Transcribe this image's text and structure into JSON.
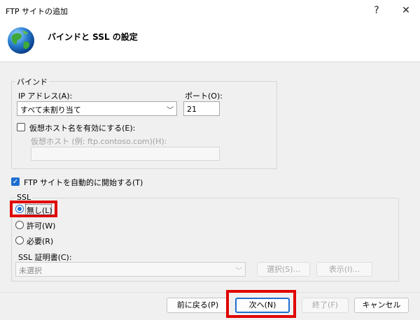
{
  "window": {
    "title": "FTP サイトの追加",
    "help_glyph": "?",
    "close_glyph": "✕"
  },
  "header": {
    "title": "バインドと SSL の設定"
  },
  "binding": {
    "group_label": "バインド",
    "ip_label": "IP アドレス(A):",
    "ip_value": "すべて未割り当て",
    "port_label": "ポート(O):",
    "port_value": "21",
    "virtual_host_checkbox_label": "仮想ホスト名を有効にする(E):",
    "virtual_host_checked": false,
    "virtual_host_label": "仮想ホスト (例: ftp.contoso.com)(H):",
    "virtual_host_value": ""
  },
  "autostart": {
    "label": "FTP サイトを自動的に開始する(T)",
    "checked": true
  },
  "ssl": {
    "group_label": "SSL",
    "options": [
      {
        "label": "無し(L)",
        "selected": true
      },
      {
        "label": "許可(W)",
        "selected": false
      },
      {
        "label": "必要(R)",
        "selected": false
      }
    ],
    "cert_label": "SSL 証明書(C):",
    "cert_value": "未選択",
    "select_button": "選択(S)...",
    "view_button": "表示(I)..."
  },
  "footer": {
    "back_button": "前に戻る(P)",
    "next_button": "次へ(N)",
    "finish_button": "終了(F)",
    "cancel_button": "キャンセル"
  },
  "colors": {
    "accent": "#1e6fd0",
    "highlight": "#e00000"
  },
  "icons": {
    "header": "globe-icon",
    "dropdown": "chevron-down-icon"
  }
}
